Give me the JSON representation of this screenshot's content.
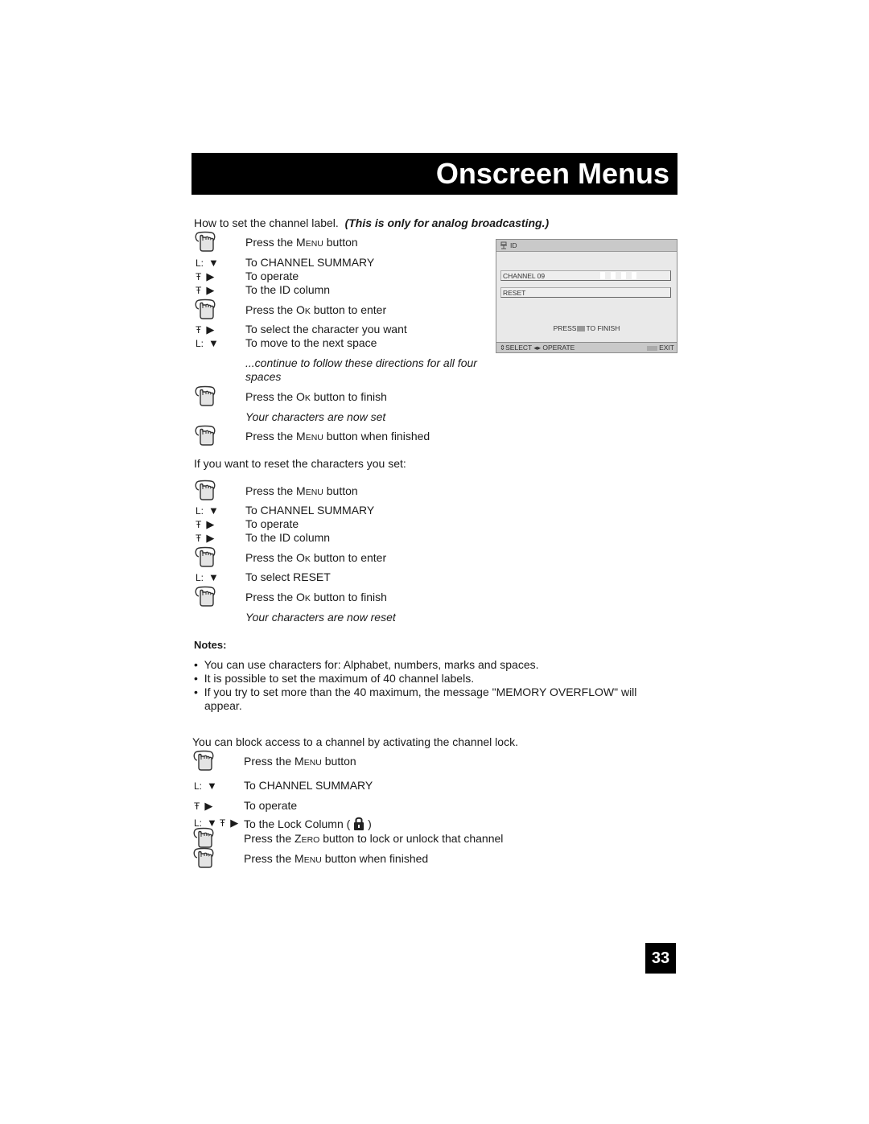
{
  "header": {
    "title": "Onscreen Menus"
  },
  "intro": {
    "text": "How to set the channel label.",
    "emphasis": "(This is only for analog broadcasting.)"
  },
  "label_steps": [
    {
      "icon": "hand",
      "pre": "Press the ",
      "key": "Menu",
      "post": " button"
    },
    {
      "icon": "keys-down",
      "keys": "L:",
      "arrow": "▼",
      "text": "To CHANNEL SUMMARY"
    },
    {
      "icon": "keys-right",
      "keys": "Ŧ",
      "arrow": "▶",
      "text": "To operate"
    },
    {
      "icon": "keys-right",
      "keys": "Ŧ",
      "arrow": "▶",
      "text": "To the ID column"
    },
    {
      "icon": "hand",
      "pre": "Press the ",
      "key": "Ok",
      "post": " button to enter"
    },
    {
      "icon": "keys-right",
      "keys": "Ŧ",
      "arrow": "▶",
      "text": "To select the character you want"
    },
    {
      "icon": "keys-down",
      "keys": "L:",
      "arrow": "▼",
      "text": "To move to the next space"
    },
    {
      "icon": "none",
      "italic": true,
      "text": "...continue to follow these directions for all four",
      "text2": "spaces"
    },
    {
      "icon": "hand",
      "pre": "Press the ",
      "key": "Ok",
      "post": " button to finish"
    },
    {
      "icon": "none",
      "italic": true,
      "text": "Your characters are now set"
    },
    {
      "icon": "hand",
      "pre": "Press the ",
      "key": "Menu",
      "post": " button when finished"
    }
  ],
  "tv_screen": {
    "title": "ID",
    "channel_field": "CHANNEL 09",
    "reset_field": "RESET",
    "press_pre": "PRESS",
    "press_post": "TO FINISH",
    "footer_left": "SELECT",
    "footer_mid": "OPERATE",
    "footer_right": "EXIT"
  },
  "reset_intro": "If you want to reset the characters you set:",
  "reset_steps": [
    {
      "icon": "hand",
      "pre": "Press the ",
      "key": "Menu",
      "post": " button"
    },
    {
      "icon": "keys-down",
      "keys": "L:",
      "arrow": "▼",
      "text": "To CHANNEL SUMMARY"
    },
    {
      "icon": "keys-right",
      "keys": "Ŧ",
      "arrow": "▶",
      "text": "To operate"
    },
    {
      "icon": "keys-right",
      "keys": "Ŧ",
      "arrow": "▶",
      "text": "To the ID column"
    },
    {
      "icon": "hand",
      "pre": "Press the ",
      "key": "Ok",
      "post": " button to enter"
    },
    {
      "icon": "keys-down",
      "keys": "L:",
      "arrow": "▼",
      "text": "To select RESET"
    },
    {
      "icon": "hand",
      "pre": "Press the ",
      "key": "Ok",
      "post": " button to finish"
    },
    {
      "icon": "none",
      "italic": true,
      "text": "Your characters are now reset"
    }
  ],
  "notes": {
    "title": "Notes:",
    "items": [
      "You can use characters for: Alphabet, numbers, marks and spaces.",
      "It is possible to set the maximum of 40 channel labels.",
      "If you try to set more than the 40 maximum, the message \"MEMORY OVERFLOW\" will",
      "appear."
    ]
  },
  "lock_intro": "You can block access to a channel by activating the channel lock.",
  "lock_steps": [
    {
      "icon": "hand",
      "pre": "Press the ",
      "key": "Menu",
      "post": " button"
    },
    {
      "icon": "keys-down",
      "keys": "L:",
      "arrow": "▼",
      "text": "To CHANNEL SUMMARY"
    },
    {
      "icon": "keys-right",
      "keys": "Ŧ",
      "arrow": "▶",
      "text": "To operate"
    },
    {
      "icon": "keys-both",
      "keys": "L:",
      "arrow": "▼",
      "keys2": "Ŧ",
      "arrow2": "▶",
      "text": "To the Lock Column (",
      "text_post": ")"
    },
    {
      "icon": "hand",
      "pre": "Press the ",
      "key": "Zero",
      "post": " button to lock or unlock that channel"
    },
    {
      "icon": "hand",
      "pre": "Press the ",
      "key": "Menu",
      "post": " button when finished"
    }
  ],
  "page_number": "33"
}
